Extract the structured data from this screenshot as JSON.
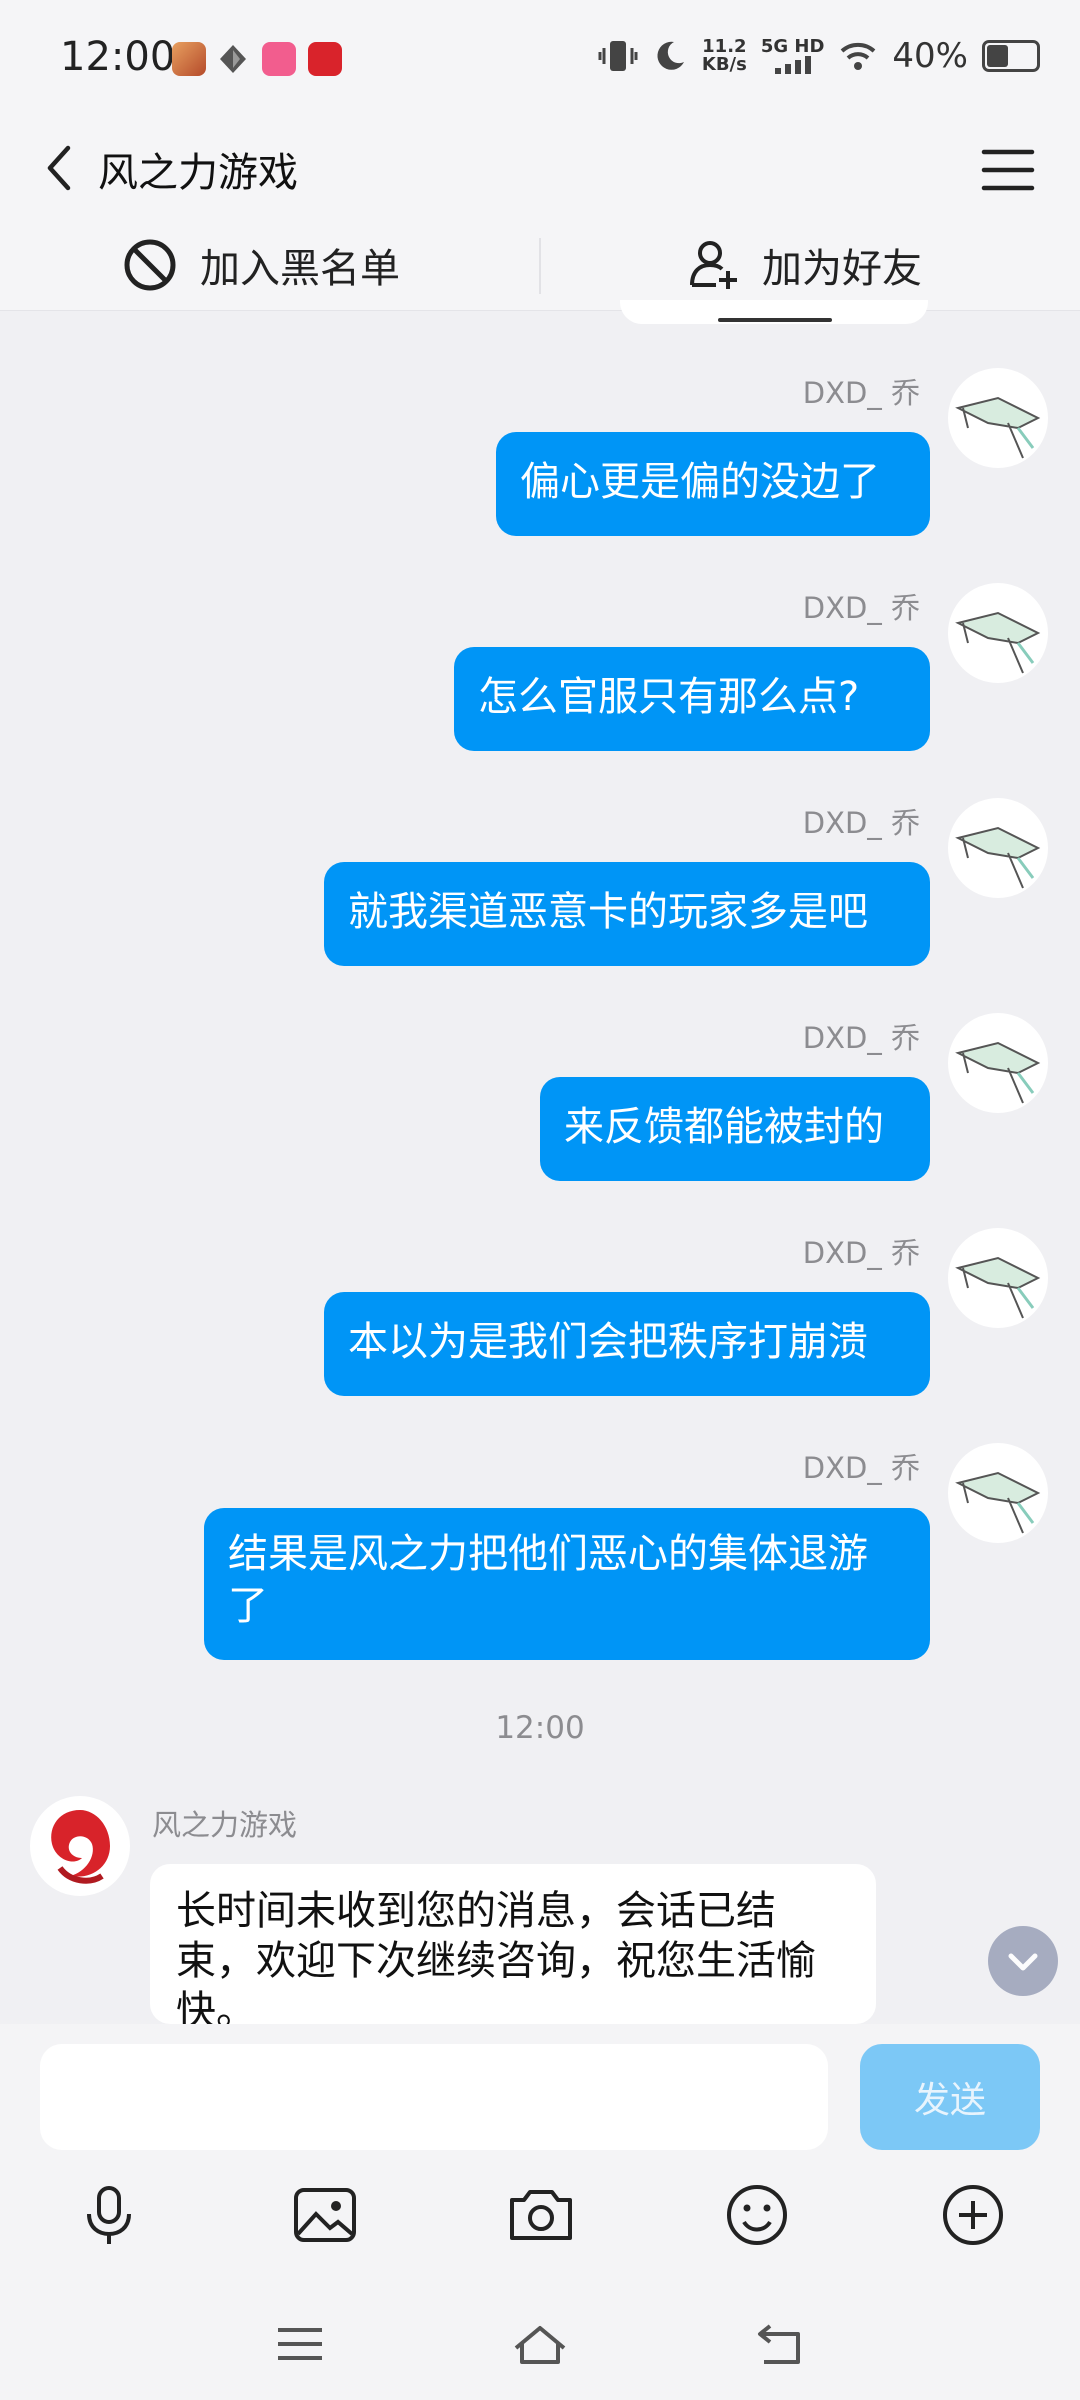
{
  "status_bar": {
    "time": "12:00",
    "net_speed_top": "11.2",
    "net_speed_unit": "KB/s",
    "network_label": "5G HD",
    "battery": "40%"
  },
  "header": {
    "title": "风之力游戏"
  },
  "actions": {
    "blacklist_label": "加入黑名单",
    "add_friend_label": "加为好友"
  },
  "messages": [
    {
      "sender": "DXD_ 乔",
      "text": "偏心更是偏的没边了"
    },
    {
      "sender": "DXD_ 乔",
      "text": "怎么官服只有那么点?"
    },
    {
      "sender": "DXD_ 乔",
      "text": "就我渠道恶意卡的玩家多是吧"
    },
    {
      "sender": "DXD_ 乔",
      "text": "来反馈都能被封的"
    },
    {
      "sender": "DXD_ 乔",
      "text": "本以为是我们会把秩序打崩溃"
    },
    {
      "sender": "DXD_ 乔",
      "text": "结果是风之力把他们恶心的集体退游了"
    }
  ],
  "time_separator": "12:00",
  "incoming": {
    "sender": "风之力游戏",
    "text": "长时间未收到您的消息，会话已结束，欢迎下次继续咨询，祝您生活愉快。"
  },
  "composer": {
    "input_value": "",
    "send_label": "发送"
  },
  "toolbar_icons": [
    "microphone-icon",
    "image-icon",
    "camera-icon",
    "emoji-icon",
    "plus-icon"
  ],
  "colors": {
    "outgoing_bubble": "#0095f6",
    "send_button": "#7cc8f6",
    "background": "#f0f0f3"
  }
}
